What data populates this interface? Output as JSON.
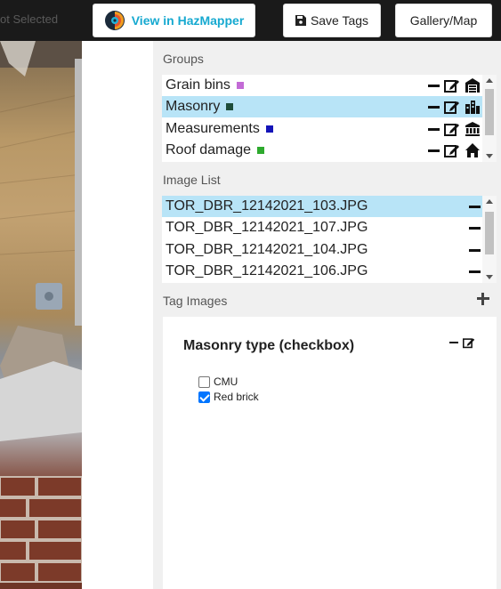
{
  "header": {
    "left_label": "ot Selected",
    "hazmapper_label": "View in HazMapper",
    "save_tags_label": "Save Tags",
    "gallery_map_label": "Gallery/Map"
  },
  "groups": {
    "title": "Groups",
    "items": [
      {
        "label": "Grain bins",
        "color": "#c36bd6",
        "icon": "warehouse-icon",
        "selected": false
      },
      {
        "label": "Masonry",
        "color": "#1e4d3a",
        "icon": "city-icon",
        "selected": true
      },
      {
        "label": "Measurements",
        "color": "#1414b8",
        "icon": "landmark-icon",
        "selected": false
      },
      {
        "label": "Roof damage",
        "color": "#2eaa2e",
        "icon": "home-icon",
        "selected": false
      }
    ]
  },
  "image_list": {
    "title": "Image List",
    "items": [
      {
        "label": "TOR_DBR_12142021_103.JPG",
        "selected": true
      },
      {
        "label": "TOR_DBR_12142021_107.JPG",
        "selected": false
      },
      {
        "label": "TOR_DBR_12142021_104.JPG",
        "selected": false
      },
      {
        "label": "TOR_DBR_12142021_106.JPG",
        "selected": false
      }
    ]
  },
  "tag_images": {
    "title": "Tag Images",
    "card_title": "Masonry type (checkbox)",
    "options": [
      {
        "label": "CMU",
        "checked": false
      },
      {
        "label": "Red brick",
        "checked": true
      }
    ]
  },
  "colors": {
    "accent": "#16a9d0",
    "selected_row": "#b8e4f7",
    "checkbox": "#0075ff"
  }
}
